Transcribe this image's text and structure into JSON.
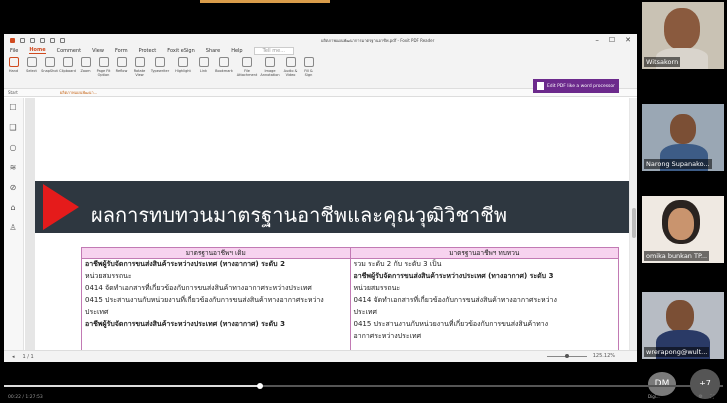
{
  "app": {
    "window_title": "ผลิตภาพแผนพัฒนาการมาตรฐานอาชีพ.pdf - Foxit PDF Reader",
    "menu": [
      "File",
      "Home",
      "Comment",
      "View",
      "Form",
      "Protect",
      "Foxit eSign",
      "Share",
      "Help"
    ],
    "active_menu": "Home",
    "search_placeholder": "Tell me...",
    "ribbon": [
      {
        "label": "Hand",
        "icon": "hand-icon"
      },
      {
        "label": "Select",
        "icon": "select-icon"
      },
      {
        "label": "SnapShot",
        "icon": "snapshot-icon"
      },
      {
        "label": "Clipboard",
        "icon": "clipboard-icon"
      },
      {
        "label": "Zoom",
        "icon": "zoom-icon"
      },
      {
        "label": "Page Fit Option",
        "icon": "page-fit-icon"
      },
      {
        "label": "Reflow",
        "icon": "reflow-icon"
      },
      {
        "label": "Rotate View",
        "icon": "rotate-icon"
      },
      {
        "label": "Typewriter",
        "icon": "typewriter-icon"
      },
      {
        "label": "Highlight",
        "icon": "highlight-icon"
      },
      {
        "label": "Link",
        "icon": "link-icon"
      },
      {
        "label": "Bookmark",
        "icon": "bookmark-icon"
      },
      {
        "label": "File Attachment",
        "icon": "attachment-icon"
      },
      {
        "label": "Image Annotation",
        "icon": "image-icon"
      },
      {
        "label": "Audio & Video",
        "icon": "audio-video-icon"
      },
      {
        "label": "Fill & Sign",
        "icon": "fill-sign-icon"
      }
    ],
    "pdf_to_word": "Edit PDF like a word processor",
    "start_tab": "Start",
    "doc_tab": "ผลิตภาพแผนพัฒนา...",
    "page_indicator": "1 / 1",
    "zoom": "125.12%"
  },
  "document": {
    "banner_title": "ผลการทบทวนมาตรฐานอาชีพและคุณวุฒิวิชาชีพ",
    "table_headers": [
      "มาตรฐานอาชีพฯ เดิม",
      "มาตรฐานอาชีพฯ ทบทวน"
    ],
    "left_column": [
      {
        "text": "อาชีพผู้รับจัดการขนส่งสินค้าระหว่างประเทศ (ทางอากาศ) ระดับ 2",
        "bold": true
      },
      {
        "text": "หน่วยสมรรถนะ",
        "bold": false
      },
      {
        "text": "0414 จัดทำเอกสารที่เกี่ยวข้องกับการขนส่งสินค้าทางอากาศระหว่างประเทศ",
        "bold": false
      },
      {
        "text": "0415 ประสานงานกับหน่วยงานที่เกี่ยวข้องกับการขนส่งสินค้าทางอากาศระหว่าง",
        "bold": false
      },
      {
        "text": "ประเทศ",
        "bold": false
      },
      {
        "text": "อาชีพผู้รับจัดการขนส่งสินค้าระหว่างประเทศ (ทางอากาศ) ระดับ 3",
        "bold": true
      }
    ],
    "right_column": [
      {
        "text": "รวม ระดับ 2 กับ ระดับ 3 เป็น",
        "bold": false
      },
      {
        "text": "อาชีพผู้รับจัดการขนส่งสินค้าระหว่างประเทศ (ทางอากาศ) ระดับ 3",
        "bold": true
      },
      {
        "text": "หน่วยสมรรถนะ",
        "bold": false
      },
      {
        "text": "0414 จัดทำเอกสารที่เกี่ยวข้องกับการขนส่งสินค้าทางอากาศระหว่าง",
        "bold": false
      },
      {
        "text": "ประเทศ",
        "bold": false
      },
      {
        "text": "0415 ประสานงานกับหน่วยงานที่เกี่ยวข้องกับการขนส่งสินค้าทาง",
        "bold": false
      },
      {
        "text": "อากาศระหว่างประเทศ",
        "bold": false
      }
    ]
  },
  "participants": [
    {
      "name": "Witsakorn"
    },
    {
      "name": "Narong Supanako..."
    },
    {
      "name": "omika bunkan TP..."
    },
    {
      "name": "wrerapong@wult..."
    }
  ],
  "more_participants": "DM",
  "more_sub": "Digi...",
  "overflow_count": "+7",
  "playback": {
    "position": 0.356,
    "time": "00:22 / 1:27:53"
  },
  "colors": {
    "banner": "#2e3740",
    "banner_accent": "#e51b1b",
    "table_header": "#f7d3ef",
    "foxit_accent": "#d04a1f"
  }
}
